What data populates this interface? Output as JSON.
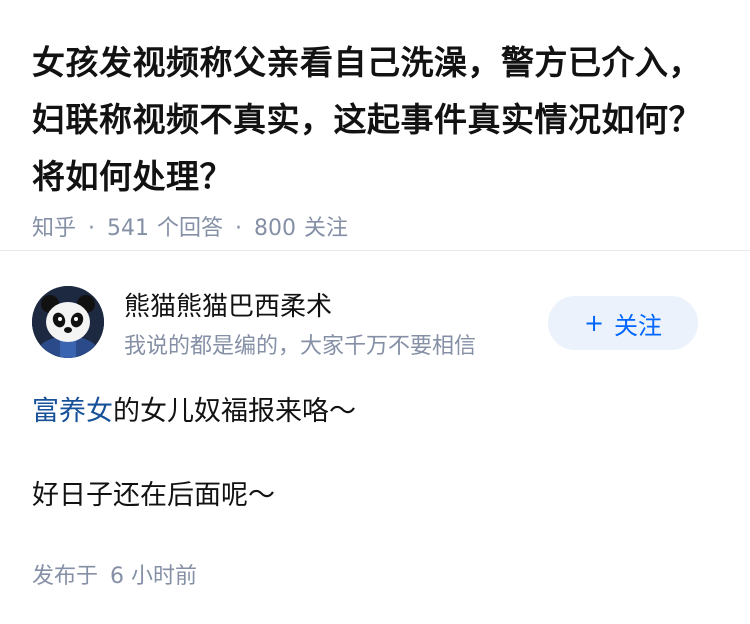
{
  "question": {
    "title": "女孩发视频称父亲看自己洗澡，警方已介入，妇联称视频不真实，这起事件真实情况如何？将如何处理？",
    "source": "知乎",
    "answer_count": "541",
    "answer_label": "个回答",
    "follow_count": "800",
    "follow_label": "关注"
  },
  "author": {
    "name": "熊猫熊猫巴西柔术",
    "bio": "我说的都是编的，大家千万不要相信",
    "follow_plus": "+",
    "follow_label": "关注"
  },
  "answer": {
    "link_text": "富养女",
    "line1_rest": "的女儿奴福报来咯～",
    "line2": "好日子还在后面呢～"
  },
  "post": {
    "prefix": "发布于",
    "time": "6 小时前"
  },
  "colors": {
    "link": "#175199",
    "accent": "#0066ff",
    "muted": "#8590a6",
    "follow_bg": "#ebf2fc"
  }
}
